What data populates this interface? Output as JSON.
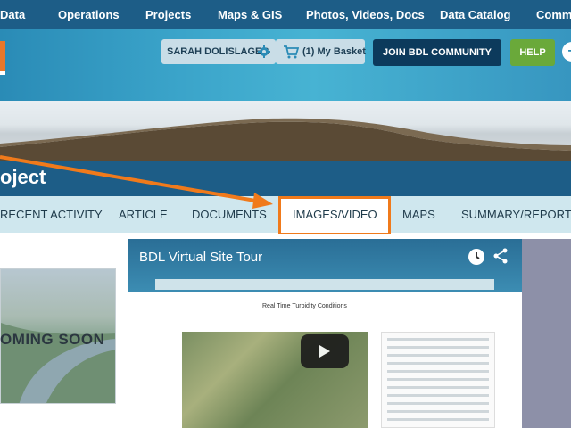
{
  "topnav": {
    "items": [
      "Data",
      "Operations",
      "Projects",
      "Maps & GIS",
      "Photos, Videos, Docs",
      "Data Catalog",
      "Commu"
    ]
  },
  "header": {
    "user_name": "SARAH DOLISLAGER",
    "basket_label": "(1) My Basket",
    "join_label": "JOIN BDL COMMUNITY",
    "help_label": "HELP",
    "plus_label": "+"
  },
  "project": {
    "title": "oject"
  },
  "tabs": {
    "items": [
      "RECENT ACTIVITY",
      "ARTICLE",
      "DOCUMENTS",
      "IMAGES/VIDEO",
      "MAPS",
      "SUMMARY/REPORT"
    ],
    "active": "IMAGES/VIDEO"
  },
  "coming_soon": {
    "label": "OMING SOON"
  },
  "video": {
    "title": "BDL Virtual Site Tour",
    "inner_title": "Real Time Turbidity Conditions"
  },
  "colors": {
    "nav": "#1d5d87",
    "highlight": "#f07a1b",
    "join": "#0c3a5c",
    "help": "#6aa93a",
    "tabs_bg": "#cfe7ee"
  },
  "icons": {
    "gear": "gear-icon",
    "cart": "cart-icon",
    "clock": "clock-icon",
    "share": "share-icon",
    "play": "play-icon",
    "arrow": "arrow-annotation"
  }
}
